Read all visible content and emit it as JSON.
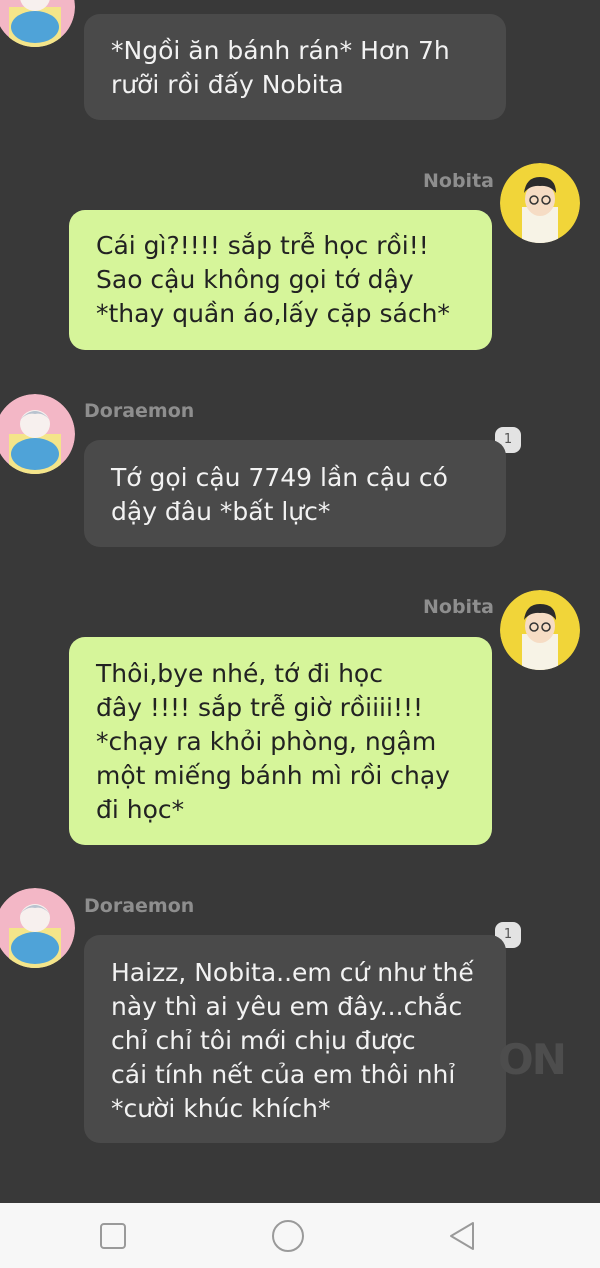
{
  "messages": [
    {
      "side": "left",
      "text": "*Ngồi ăn bánh rán* Hơn 7h\nrưỡi rồi đấy Nobita"
    },
    {
      "side": "right",
      "sender": "Nobita",
      "text": "Cái gì?!!!! sắp trễ học rồi!!\nSao cậu không gọi tớ dậy\n*thay quần áo,lấy cặp sách*"
    },
    {
      "side": "left",
      "sender": "Doraemon",
      "badge": "1",
      "text": "Tớ gọi cậu 7749 lần cậu có\ndậy đâu *bất lực*"
    },
    {
      "side": "right",
      "sender": "Nobita",
      "text": "Thôi,bye nhé, tớ đi học\nđây !!!! sắp trễ giờ rồiiii!!!\n*chạy ra khỏi phòng, ngậm\nmột miếng bánh mì rồi chạy\nđi học*"
    },
    {
      "side": "left",
      "sender": "Doraemon",
      "badge": "1",
      "text": "Haizz, Nobita..em cứ như thế\nnày thì ai yêu em đây...chắc\nchỉ chỉ tôi mới chịu được\ncái tính nết của em thôi nhỉ\n*cười khúc khích*"
    }
  ],
  "watermark": "ON",
  "colors": {
    "background": "#393939",
    "bubble_left": "#4a4a4a",
    "bubble_right": "#d6f59a",
    "navbar": "#f7f7f7"
  },
  "icons": {
    "nav_recent": "square-icon",
    "nav_home": "circle-icon",
    "nav_back": "triangle-back-icon"
  }
}
